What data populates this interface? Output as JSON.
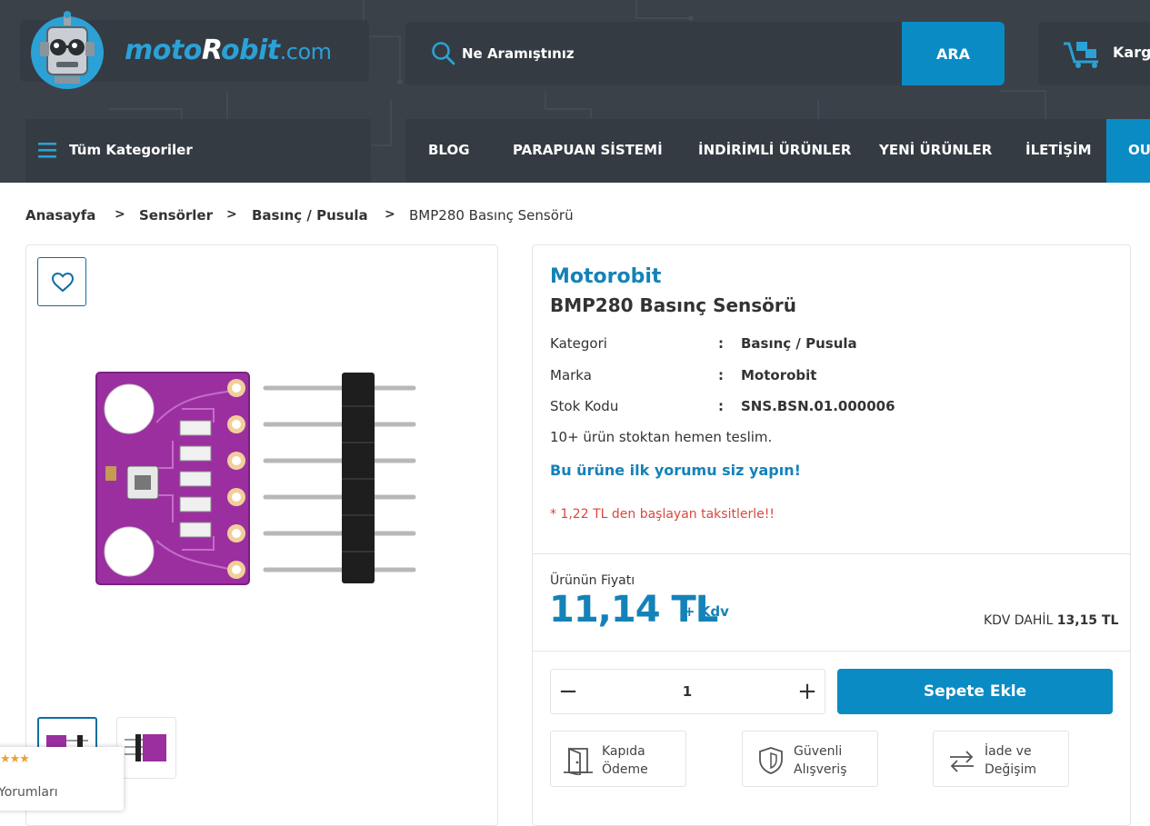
{
  "header": {
    "logo": {
      "part1": "moto",
      "part2": "R",
      "part3": "obit",
      "part4": ".com"
    },
    "search": {
      "placeholder": "Ne Aramıştınız",
      "button_label": "ARA"
    },
    "cargo_label": "Karg",
    "categories_label": "Tüm Kategoriler",
    "nav": [
      {
        "label": "BLOG"
      },
      {
        "label": "PARAPUAN SİSTEMİ"
      },
      {
        "label": "İNDİRİMLİ ÜRÜNLER"
      },
      {
        "label": "YENİ ÜRÜNLER"
      },
      {
        "label": "İLETİŞİM"
      },
      {
        "label": "OU"
      }
    ]
  },
  "breadcrumb": {
    "items": [
      "Anasayfa",
      "Sensörler",
      "Basınç / Pusula",
      "BMP280 Basınç Sensörü"
    ],
    "separator": ">"
  },
  "gallery": {
    "review_widget": {
      "stars": "★★★",
      "label": "Yorumları"
    }
  },
  "product": {
    "brand": "Motorobit",
    "title": "BMP280 Basınç Sensörü",
    "attributes": [
      {
        "label": "Kategori",
        "colon": ":",
        "value": "Basınç / Pusula"
      },
      {
        "label": "Marka",
        "colon": ":",
        "value": "Motorobit"
      },
      {
        "label": "Stok Kodu",
        "colon": ":",
        "value": "SNS.BSN.01.000006"
      }
    ],
    "stock_note": "10+ ürün stoktan hemen teslim.",
    "review_link": "Bu ürüne ilk yorumu siz yapın!",
    "installment_note": "* 1,22 TL den başlayan taksitlerle!!",
    "price_label": "Ürünün Fiyatı",
    "price": "11,14 TL",
    "price_suffix": "+ Kdv",
    "price_incl_label": "KDV DAHİL",
    "price_incl_value": "13,15 TL",
    "quantity": "1",
    "qty_minus": "−",
    "qty_plus": "+",
    "add_to_cart": "Sepete Ekle",
    "features": [
      {
        "line1": "Kapıda",
        "line2": "Ödeme",
        "icon": "door-icon"
      },
      {
        "line1": "Güvenli",
        "line2": "Alışveriş",
        "icon": "shield-icon"
      },
      {
        "line1": "İade ve",
        "line2": "Değişim",
        "icon": "exchange-icon"
      }
    ]
  },
  "colors": {
    "header_bg": "#3a4148",
    "accent": "#0b8bc4",
    "brand_blue": "#1482b8",
    "warning_red": "#d9473d",
    "pcb_purple": "#9b2fa0"
  }
}
